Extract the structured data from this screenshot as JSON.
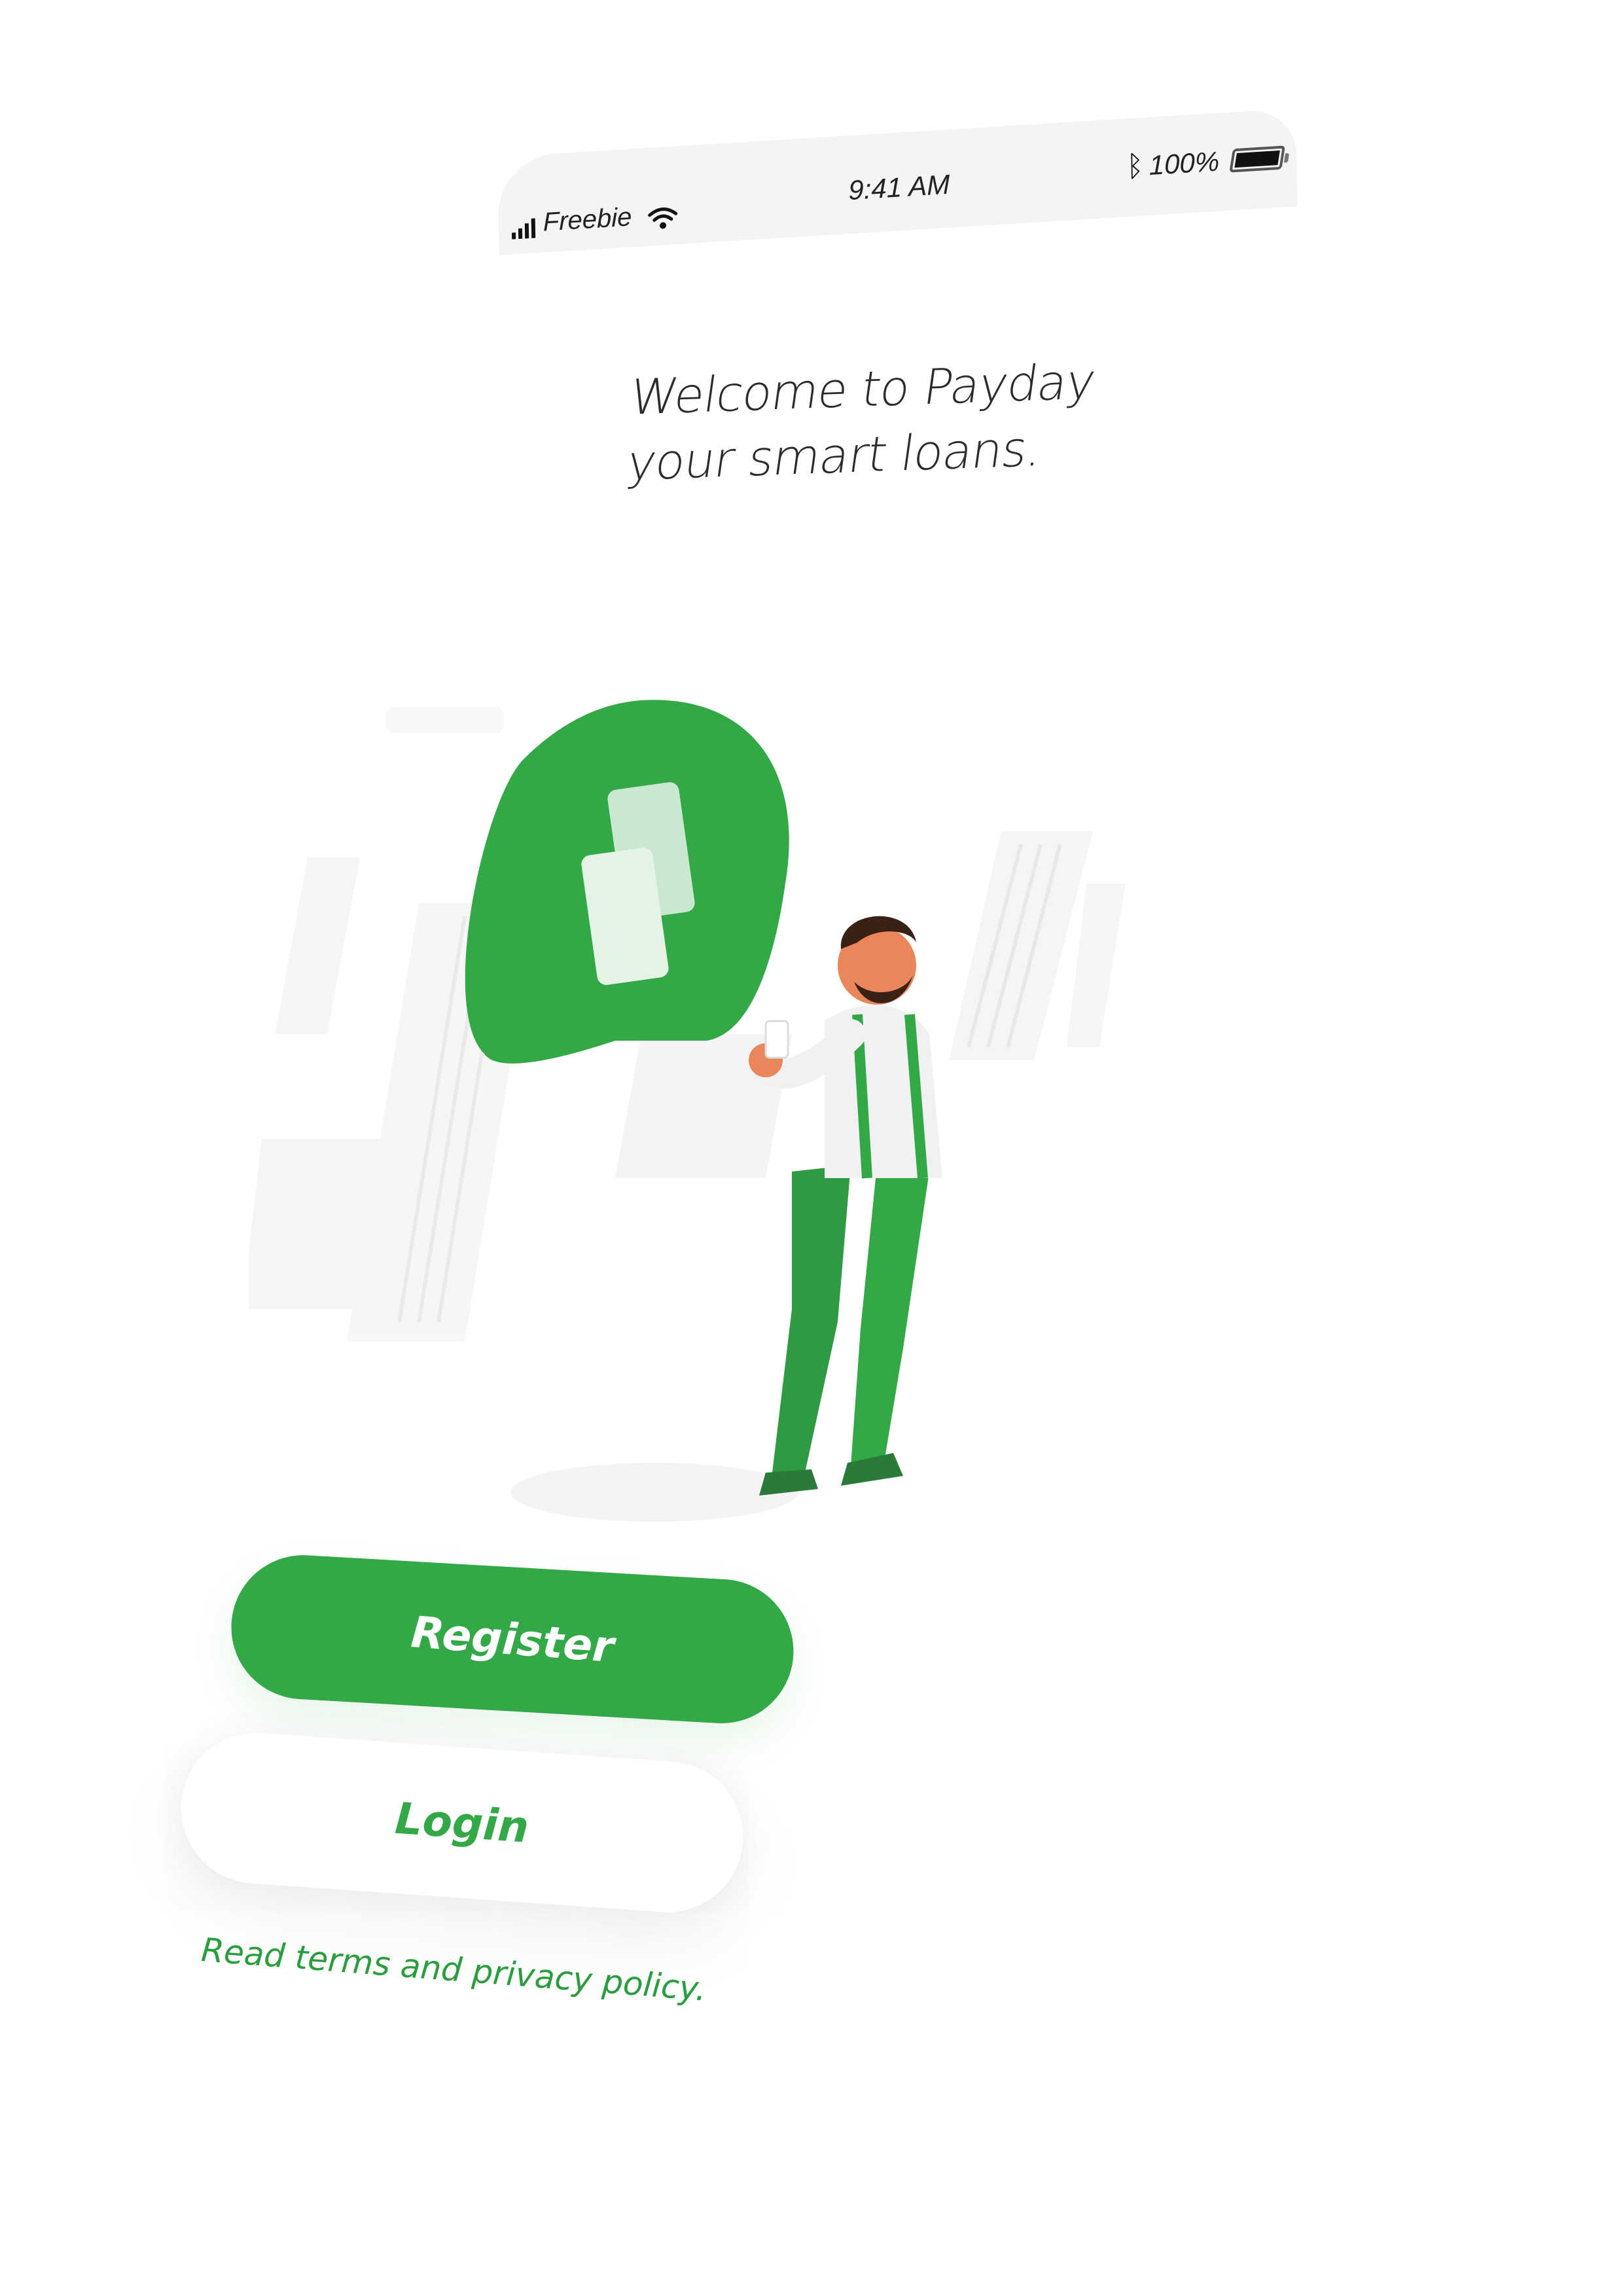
{
  "status_bar": {
    "carrier": "Freebie",
    "time": "9:41 AM",
    "battery": "100%",
    "icons": [
      "signal-icon",
      "wifi-icon",
      "bluetooth-icon",
      "battery-icon"
    ]
  },
  "welcome": {
    "line1": "Welcome to Payday",
    "line2": "your smart loans."
  },
  "illustration": {
    "name": "man-with-phone-and-speech-bubble",
    "brand_icon": "payday-logo-icon"
  },
  "actions": {
    "register_label": "Register",
    "login_label": "Login",
    "terms_label": "Read terms and privacy policy."
  },
  "colors": {
    "accent": "#33a847",
    "text_dark": "#2c2c2c",
    "status_bg": "#f4f4f6",
    "background": "#ffffff"
  }
}
